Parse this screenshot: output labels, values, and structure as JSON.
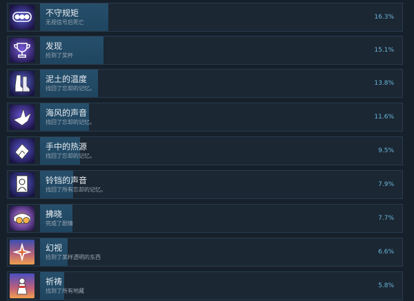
{
  "achievements": [
    {
      "title": "不守规矩",
      "desc": "无视信号后死亡",
      "percent": "16.3%",
      "fill": 0.163,
      "icon": "traffic-light-icon"
    },
    {
      "title": "发现",
      "desc": "捡到了奖杯",
      "percent": "15.1%",
      "fill": 0.151,
      "icon": "trophy-icon"
    },
    {
      "title": "泥土的温度",
      "desc": "找回了忘却的记忆。",
      "percent": "13.8%",
      "fill": 0.138,
      "icon": "boots-icon"
    },
    {
      "title": "海风的声音",
      "desc": "找回了忘却的记忆。",
      "percent": "11.6%",
      "fill": 0.116,
      "icon": "paper-crane-icon"
    },
    {
      "title": "手中的热源",
      "desc": "找回了忘却的记忆。",
      "percent": "9.5%",
      "fill": 0.095,
      "icon": "leaf-heart-icon"
    },
    {
      "title": "铃铛的声音",
      "desc": "找回了所有忘却的记忆。",
      "percent": "7.9%",
      "fill": 0.079,
      "icon": "photo-frame-icon"
    },
    {
      "title": "拂晓",
      "desc": "完成了剧情",
      "percent": "7.7%",
      "fill": 0.077,
      "icon": "sleeping-face-icon"
    },
    {
      "title": "幻视",
      "desc": "捡到了某样透明的东西",
      "percent": "6.6%",
      "fill": 0.066,
      "icon": "sparkle-icon"
    },
    {
      "title": "祈祷",
      "desc": "找到了所有地藏",
      "percent": "5.8%",
      "fill": 0.058,
      "icon": "jizo-statue-icon"
    }
  ]
}
